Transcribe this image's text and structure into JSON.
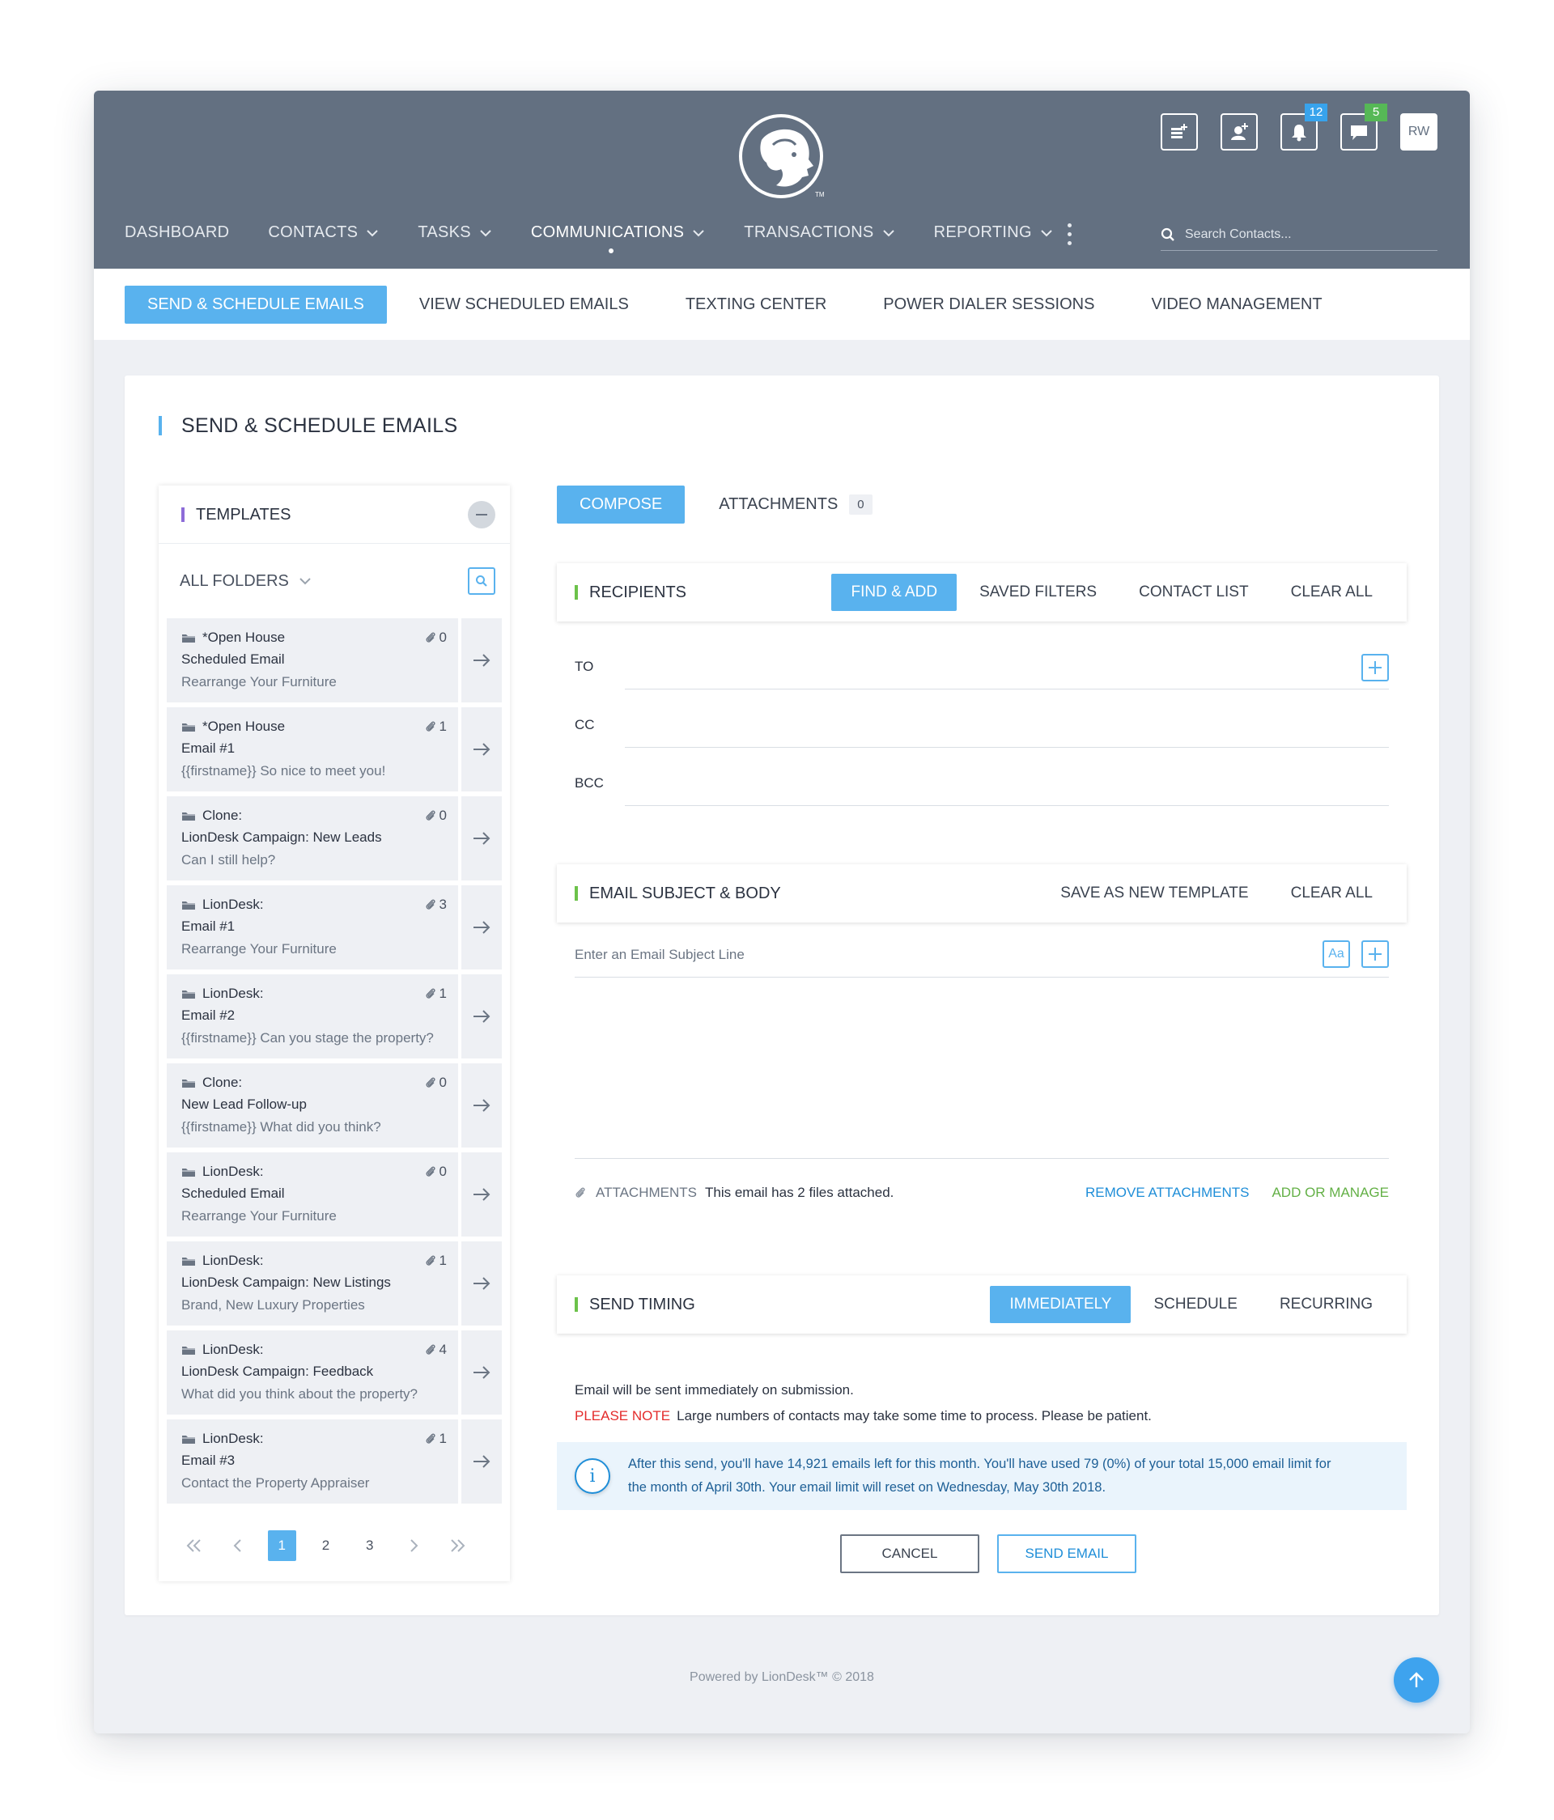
{
  "header": {
    "logo_icon": "lion-logo-icon",
    "nav": [
      {
        "label": "DASHBOARD",
        "dropdown": false
      },
      {
        "label": "CONTACTS",
        "dropdown": true
      },
      {
        "label": "TASKS",
        "dropdown": true
      },
      {
        "label": "COMMUNICATIONS",
        "dropdown": true,
        "active": true
      },
      {
        "label": "TRANSACTIONS",
        "dropdown": true
      },
      {
        "label": "REPORTING",
        "dropdown": true
      }
    ],
    "search_placeholder": "Search Contacts...",
    "notifications_count": "12",
    "messages_count": "5",
    "avatar_initials": "RW"
  },
  "subnav": [
    {
      "label": "SEND & SCHEDULE EMAILS",
      "active": true
    },
    {
      "label": "VIEW SCHEDULED EMAILS"
    },
    {
      "label": "TEXTING CENTER"
    },
    {
      "label": "POWER DIALER SESSIONS"
    },
    {
      "label": "VIDEO MANAGEMENT"
    }
  ],
  "page_title": "SEND & SCHEDULE EMAILS",
  "templates": {
    "title": "TEMPLATES",
    "folder_label": "ALL FOLDERS",
    "items": [
      {
        "line1": "*Open House",
        "line2": "Scheduled Email",
        "line3": "Rearrange Your Furniture",
        "count": "0"
      },
      {
        "line1": "*Open House",
        "line2": "Email #1",
        "line3": "{{firstname}} So nice to meet you!",
        "count": "1"
      },
      {
        "line1": "Clone:",
        "line2": "LionDesk Campaign: New Leads",
        "line3": "Can I still help?",
        "count": "0"
      },
      {
        "line1": "LionDesk:",
        "line2": "Email #1",
        "line3": "Rearrange Your Furniture",
        "count": "3"
      },
      {
        "line1": "LionDesk:",
        "line2": "Email #2",
        "line3": "{{firstname}} Can you stage the property?",
        "count": "1"
      },
      {
        "line1": "Clone:",
        "line2": "New Lead Follow-up",
        "line3": "{{firstname}} What did you think?",
        "count": "0"
      },
      {
        "line1": "LionDesk:",
        "line2": "Scheduled Email",
        "line3": "Rearrange Your Furniture",
        "count": "0"
      },
      {
        "line1": "LionDesk:",
        "line2": "LionDesk Campaign: New Listings",
        "line3": "Brand, New Luxury Properties",
        "count": "1"
      },
      {
        "line1": "LionDesk:",
        "line2": "LionDesk Campaign: Feedback",
        "line3": "What did you think about the property?",
        "count": "4"
      },
      {
        "line1": "LionDesk:",
        "line2": "Email #3",
        "line3": "Contact the Property Appraiser",
        "count": "1"
      }
    ],
    "pages": [
      "1",
      "2",
      "3"
    ],
    "current_page": "1"
  },
  "compose": {
    "tab_compose": "COMPOSE",
    "tab_attachments": "ATTACHMENTS",
    "attachments_count": "0"
  },
  "recipients": {
    "title": "RECIPIENTS",
    "find_add": "FIND & ADD",
    "saved_filters": "SAVED FILTERS",
    "contact_list": "CONTACT LIST",
    "clear_all": "CLEAR ALL",
    "to_label": "TO",
    "cc_label": "CC",
    "bcc_label": "BCC"
  },
  "subject_body": {
    "title": "EMAIL SUBJECT & BODY",
    "save_template": "SAVE AS NEW TEMPLATE",
    "clear_all": "CLEAR ALL",
    "subject_placeholder": "Enter an Email Subject Line",
    "aa_label": "Aa",
    "attachments_label": "ATTACHMENTS",
    "attachments_desc": "This email has 2 files attached.",
    "remove_attachments": "REMOVE ATTACHMENTS",
    "add_or_manage": "ADD OR MANAGE"
  },
  "send_timing": {
    "title": "SEND TIMING",
    "immediately": "IMMEDIATELY",
    "schedule": "SCHEDULE",
    "recurring": "RECURRING",
    "desc": "Email will be sent immediately on submission.",
    "note_label": "PLEASE NOTE",
    "note_text": "Large numbers of contacts may take some time to process. Please be patient."
  },
  "info": {
    "text_line1": "After this send, you'll have 14,921 emails left for this month. You'll have used 79 (0%) of your total 15,000 email limit for",
    "text_line2": "the month of April 30th. Your email limit will reset on Wednesday, May 30th 2018."
  },
  "actions": {
    "cancel": "CANCEL",
    "send": "SEND EMAIL"
  },
  "footer": "Powered by LionDesk™ © 2018",
  "colors": {
    "header_bg": "#637081",
    "accent": "#59b2ee",
    "section_marker": "#6cc24a",
    "templates_marker": "#8d6cd8",
    "note_red": "#e42b2b"
  }
}
